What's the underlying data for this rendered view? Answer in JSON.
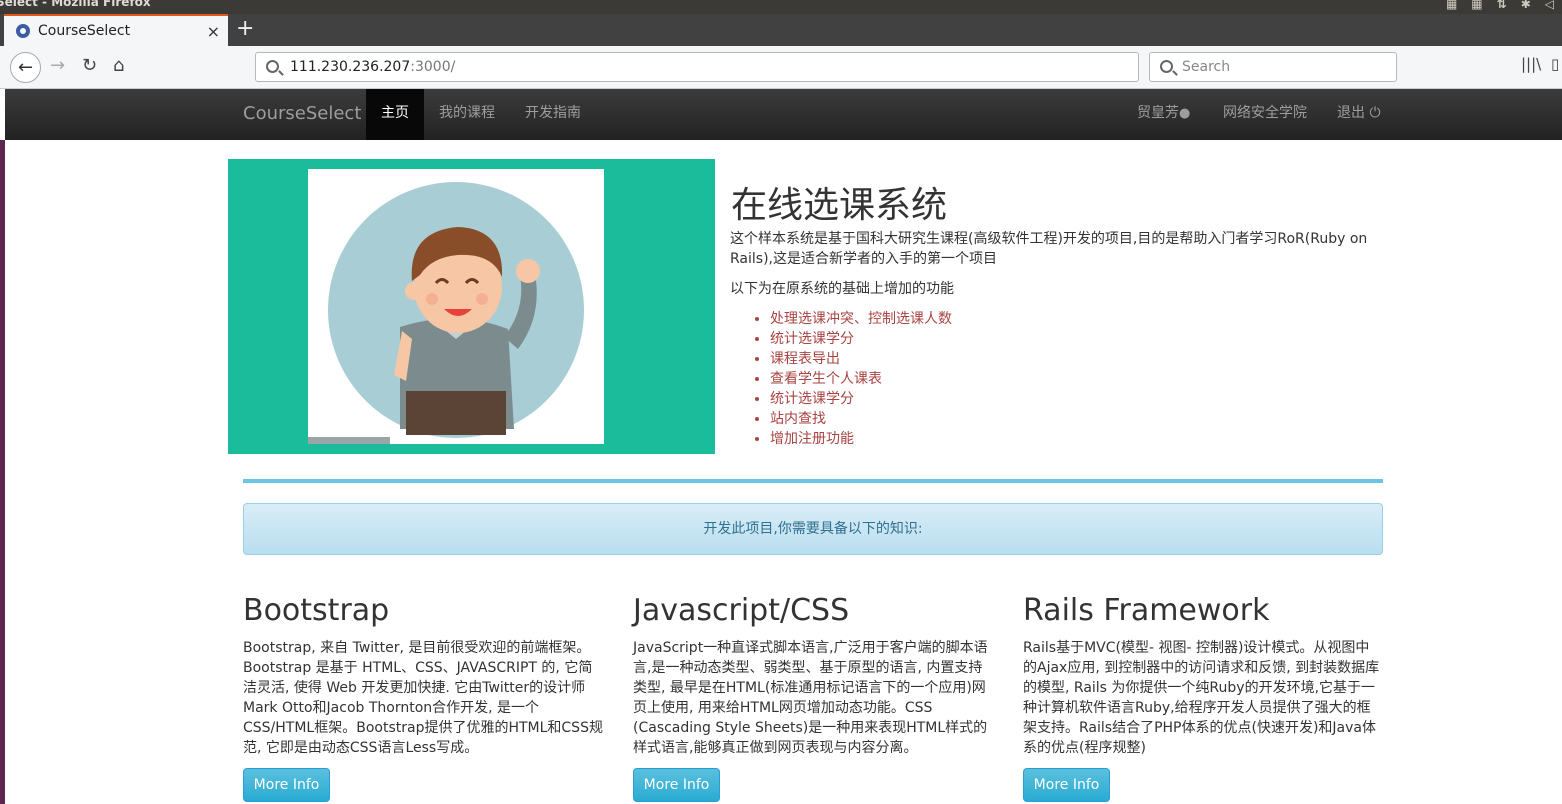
{
  "os": {
    "window_title": "Select - Mozilla Firefox"
  },
  "browser": {
    "tab_title": "CourseSelect",
    "tab_close": "×",
    "new_tab": "+",
    "url_host": "111.230.236.207",
    "url_rest": ":3000/",
    "search_placeholder": "Search"
  },
  "site": {
    "brand": "CourseSelect",
    "nav": {
      "home": "主页",
      "my_courses": "我的课程",
      "dev_guide": "开发指南"
    },
    "user": {
      "name": "贸皇芳",
      "department": "网络安全学院",
      "logout": "退出"
    }
  },
  "hero": {
    "title": "在线选课系统",
    "description": "这个样本系统是基于国科大研究生课程(高级软件工程)开发的项目,目的是帮助入门者学习RoR(Ruby on Rails),这是适合新学者的入手的第一个项目",
    "subtitle": "以下为在原系统的基础上增加的功能",
    "features": [
      "处理选课冲突、控制选课人数",
      "统计选课学分",
      "课程表导出",
      "查看学生个人课表",
      "统计选课学分",
      "站内查找",
      "增加注册功能"
    ]
  },
  "info_box": "开发此项目,你需要具备以下的知识:",
  "columns": [
    {
      "title": "Bootstrap",
      "text": "Bootstrap, 来自 Twitter, 是目前很受欢迎的前端框架。Bootstrap 是基于 HTML、CSS、JAVASCRIPT 的, 它简洁灵活, 使得 Web 开发更加快捷. 它由Twitter的设计师Mark Otto和Jacob Thornton合作开发, 是一个CSS/HTML框架。Bootstrap提供了优雅的HTML和CSS规范, 它即是由动态CSS语言Less写成。",
      "button": "More Info"
    },
    {
      "title": "Javascript/CSS",
      "text": "JavaScript一种直译式脚本语言,广泛用于客户端的脚本语言,是一种动态类型、弱类型、基于原型的语言, 内置支持类型, 最早是在HTML(标准通用标记语言下的一个应用)网页上使用, 用来给HTML网页增加动态功能。CSS (Cascading Style Sheets)是一种用来表现HTML样式的样式语言,能够真正做到网页表现与内容分离。",
      "button": "More Info"
    },
    {
      "title": "Rails Framework",
      "text": "Rails基于MVC(模型- 视图- 控制器)设计模式。从视图中的Ajax应用, 到控制器中的访问请求和反馈, 到封装数据库的模型, Rails 为你提供一个纯Ruby的开发环境,它基于一种计算机软件语言Ruby,给程序开发人员提供了强大的框架支持。Rails结合了PHP体系的优点(快速开发)和Java体系的优点(程序规整)",
      "button": "More Info"
    }
  ],
  "colors": {
    "hero_bg": "#1abc9c",
    "accent": "#5bc0de",
    "feature_text": "#a94442",
    "navbar": "#222222"
  }
}
